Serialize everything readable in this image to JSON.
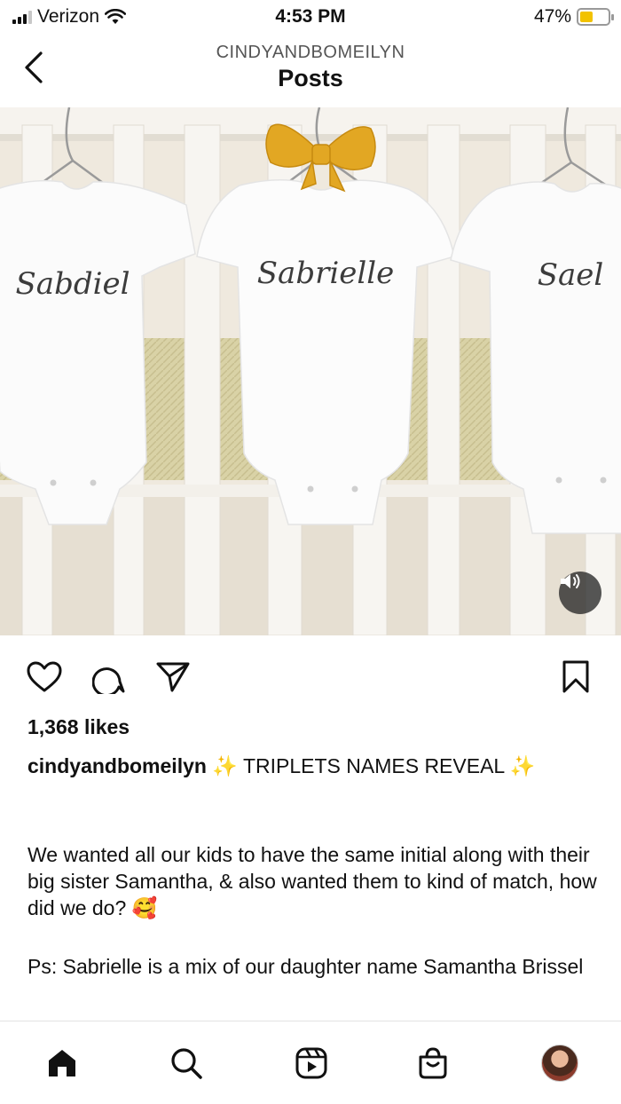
{
  "status_bar": {
    "carrier": "Verizon",
    "time": "4:53 PM",
    "battery": "47%",
    "battery_level": 0.47,
    "battery_color": "#f2c200",
    "wifi_icon": "wifi-icon"
  },
  "header": {
    "username": "CINDYANDBOMEILYN",
    "title": "Posts"
  },
  "media": {
    "onesies": [
      "Sabdiel",
      "Sabrielle",
      "Sael"
    ],
    "bow_color": "#e2a723",
    "sound_icon": "speaker-icon"
  },
  "actions": {
    "like_icon": "heart-icon",
    "comment_icon": "comment-icon",
    "share_icon": "send-icon",
    "save_icon": "bookmark-icon"
  },
  "post": {
    "likes": "1,368 likes",
    "username": "cindyandbomeilyn",
    "sparkles": "✨",
    "caption_title": "TRIPLETS NAMES REVEAL",
    "paragraph_1": "We wanted all our kids to have the same initial along with their big sister Samantha, & also wanted them to kind of match, how did we do?",
    "emoji": "🥰",
    "paragraph_2": "Ps: Sabrielle is a mix of our daughter name Samantha Brissel"
  },
  "bottom_nav": {
    "items": [
      "home-icon",
      "search-icon",
      "reels-icon",
      "shop-icon",
      "profile-avatar"
    ]
  }
}
